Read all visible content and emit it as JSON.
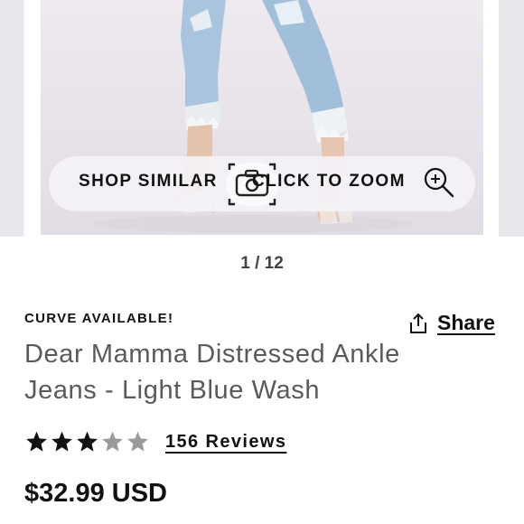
{
  "gallery": {
    "shop_similar_label": "SHOP SIMILAR",
    "click_to_zoom_label": "CLICK TO ZOOM",
    "camera_icon": "camera-search-icon",
    "zoom_icon": "zoom-in-icon",
    "pager": "1 / 12"
  },
  "product": {
    "curve_label": "CURVE AVAILABLE!",
    "share_label": "Share",
    "share_icon": "share-icon",
    "title": "Dear Mamma Distressed Ankle Jeans - Light Blue Wash",
    "rating": {
      "value": 3,
      "max": 5,
      "filled_color": "#111111",
      "empty_color": "#9a9a9a"
    },
    "reviews_label": "156 Reviews",
    "price": "$32.99 USD"
  }
}
